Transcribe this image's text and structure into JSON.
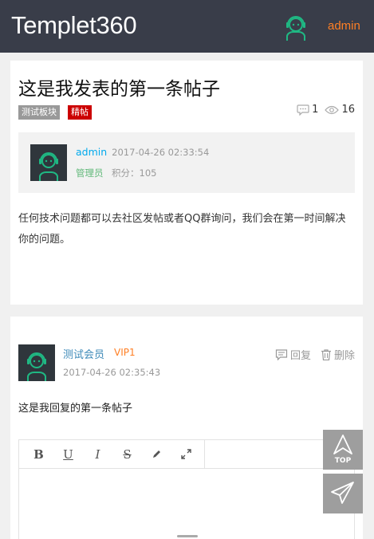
{
  "header": {
    "logo": "Templet360",
    "username": "admin"
  },
  "post": {
    "title": "这是我发表的第一条帖子",
    "board_tag": "测试板块",
    "best_tag": "精帖",
    "comment_count": "1",
    "view_count": "16",
    "author": {
      "name": "admin",
      "date": "2017-04-26 02:33:54",
      "role": "管理员",
      "points": "积分：105"
    },
    "content": "任何技术问题都可以去社区发帖或者QQ群询问，我们会在第一时间解决你的问题。"
  },
  "reply": {
    "user": "测试会员",
    "vip": "VIP1",
    "date": "2017-04-26 02:35:43",
    "reply_label": "回复",
    "delete_label": "删除",
    "content": "这是我回复的第一条帖子"
  },
  "editor": {
    "tools": [
      "bold",
      "underline",
      "italic",
      "strikethrough",
      "pen",
      "fullscreen"
    ],
    "bold_glyph": "B",
    "underline_glyph": "U",
    "italic_glyph": "I",
    "strike_glyph": "S"
  },
  "float": {
    "top_label": "TOP"
  },
  "colors": {
    "header_bg": "#393d49",
    "username": "#ff7f24",
    "link_blue": "#01aaed",
    "role_green": "#5fb878",
    "best_red": "#cc0000"
  }
}
